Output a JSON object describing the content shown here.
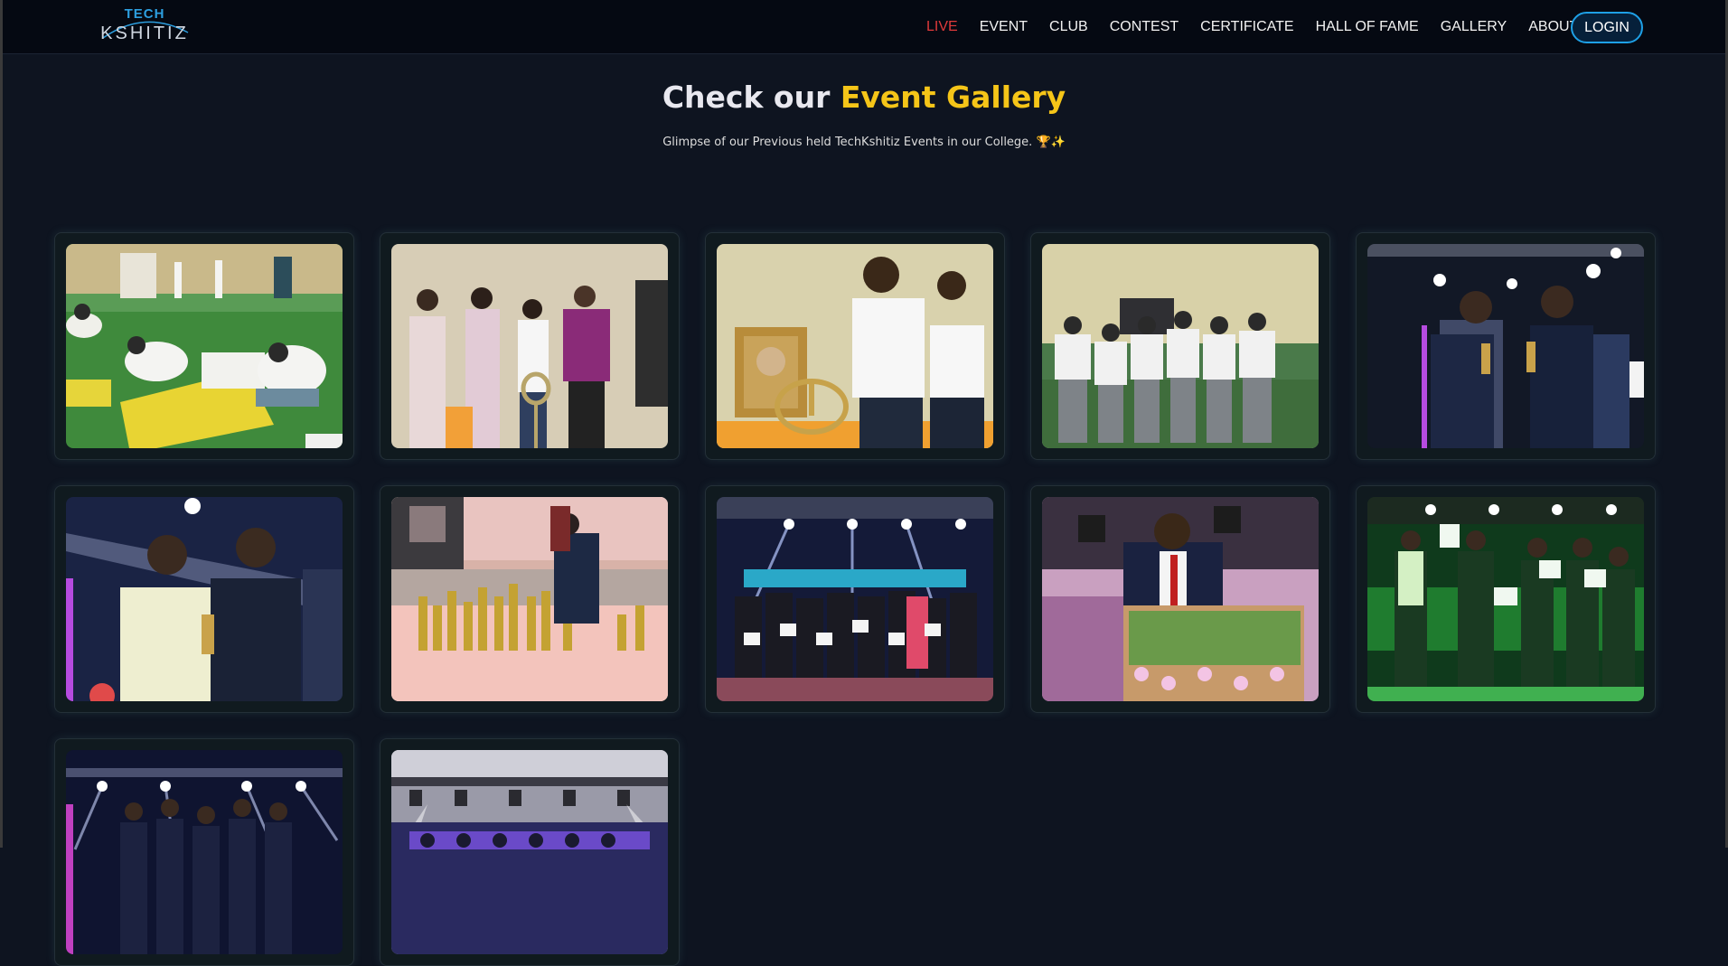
{
  "nav": {
    "logo_top": "TECH",
    "logo_bottom": "KSHITIZ",
    "links": [
      "LIVE",
      "EVENT",
      "CLUB",
      "CONTEST",
      "CERTIFICATE",
      "HALL OF FAME",
      "GALLERY",
      "ABOUT"
    ],
    "login_label": "LOGIN",
    "live_color": "#e03a3a",
    "login_border_color": "#1ea0e6"
  },
  "hero": {
    "title_prefix": "Check our ",
    "title_accent": "Event Gallery",
    "accent_color": "#f5c518",
    "subtitle": "Glimpse of our Previous held TechKshitiz Events in our College. 🏆✨"
  },
  "gallery": {
    "photos": [
      {
        "scene": "students drawing posters on green floor"
      },
      {
        "scene": "lamp lighting ceremony guests"
      },
      {
        "scene": "man lighting ceremonial lamp"
      },
      {
        "scene": "students in white tshirts standing"
      },
      {
        "scene": "two men holding trophies on stage"
      },
      {
        "scene": "award handover on stage"
      },
      {
        "scene": "trophies arranged on table"
      },
      {
        "scene": "group photo with certificates on stage"
      },
      {
        "scene": "speaker at podium with microphone"
      },
      {
        "scene": "winners with certificates under green light"
      },
      {
        "scene": "group on stage under lights"
      },
      {
        "scene": "stage with lights and audience"
      }
    ]
  }
}
